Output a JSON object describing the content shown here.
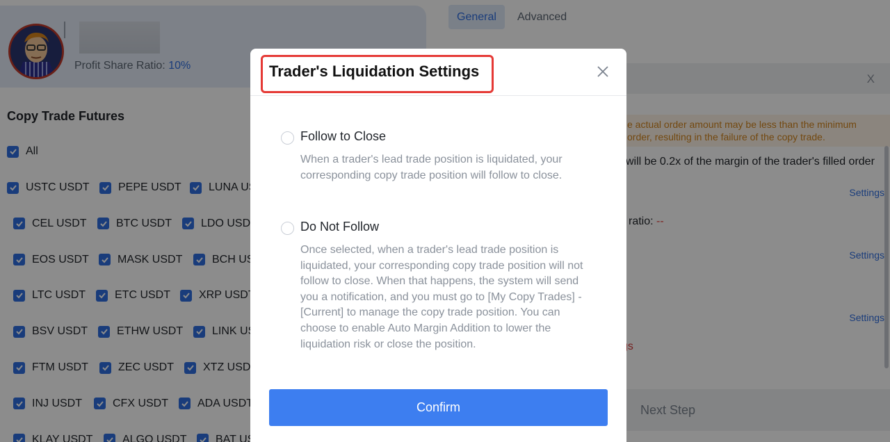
{
  "trader": {
    "share_label": "Profit Share Ratio:",
    "share_value": "10%"
  },
  "copy_trade": {
    "title": "Copy Trade Futures",
    "all_label": "All",
    "rows": [
      [
        "USTC USDT",
        "PEPE USDT",
        "LUNA USDT"
      ],
      [
        "CEL USDT",
        "BTC USDT",
        "LDO USDT"
      ],
      [
        "EOS USDT",
        "MASK USDT",
        "BCH USDT"
      ],
      [
        "LTC USDT",
        "ETC USDT",
        "XRP USDT"
      ],
      [
        "BSV USDT",
        "ETHW USDT",
        "LINK USDT"
      ],
      [
        "FTM USDT",
        "ZEC USDT",
        "XTZ USDT"
      ],
      [
        "INJ USDT",
        "CFX USDT",
        "ADA USDT"
      ],
      [
        "KLAY USDT",
        "ALGO USDT",
        "BAT USDT"
      ]
    ]
  },
  "tabs": {
    "general": "General",
    "advanced": "Advanced"
  },
  "notice": {
    "close": "X"
  },
  "warning": {
    "line1": "e actual order amount may be less than the minimum",
    "line2": "order, resulting in the failure of the copy trade."
  },
  "margin_text": "will be 0.2x of the margin of the trader's filled order",
  "settings_label": "Settings",
  "ratio": {
    "label": "ratio:",
    "value": "--"
  },
  "gs_text": "gs",
  "next_step": "Next Step",
  "modal": {
    "title": "Trader's Liquidation Settings",
    "options": [
      {
        "label": "Follow to Close",
        "description": "When a trader's lead trade position is liquidated, your corresponding copy trade position will follow to close."
      },
      {
        "label": "Do Not Follow",
        "description": "Once selected, when a trader's lead trade position is liquidated, your corresponding copy trade position will not follow to close. When that happens, the system will send you a notification, and you must go to [My Copy Trades] - [Current] to manage the copy trade position. You can choose to enable Auto Margin Addition to lower the liquidation risk or close the position."
      }
    ],
    "confirm_label": "Confirm"
  },
  "colors": {
    "accent": "#3d7ef0",
    "highlight": "#e53935",
    "warning_text": "#d2841c"
  }
}
